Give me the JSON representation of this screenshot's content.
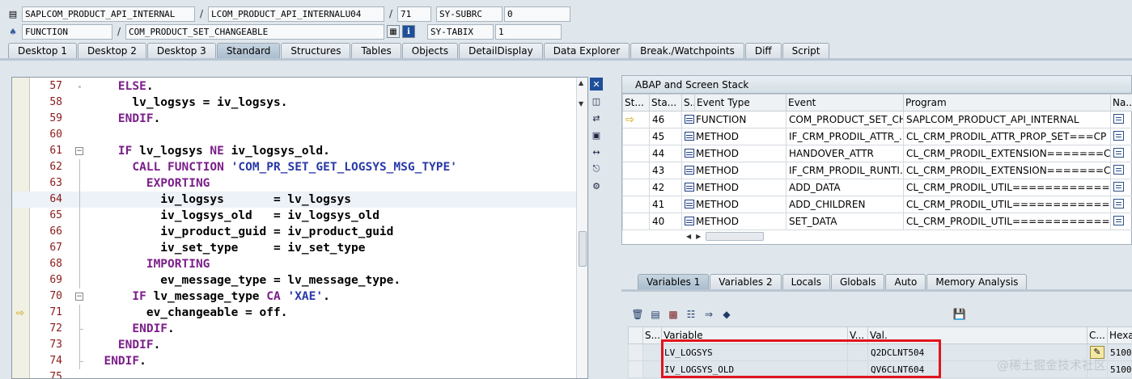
{
  "header": {
    "program": "SAPLCOM_PRODUCT_API_INTERNAL",
    "include": "LCOM_PRODUCT_API_INTERNALU04",
    "line": "71",
    "subrc_label": "SY-SUBRC",
    "subrc_value": "0",
    "event_type": "FUNCTION",
    "event": "COM_PRODUCT_SET_CHANGEABLE",
    "tabix_label": "SY-TABIX",
    "tabix_value": "1",
    "sep": "/",
    "info_btn": "i"
  },
  "main_tabs": [
    "Desktop 1",
    "Desktop 2",
    "Desktop 3",
    "Standard",
    "Structures",
    "Tables",
    "Objects",
    "DetailDisplay",
    "Data Explorer",
    "Break./Watchpoints",
    "Diff",
    "Script"
  ],
  "active_main_tab": "Standard",
  "code": [
    {
      "n": "57",
      "t": "    ELSE."
    },
    {
      "n": "58",
      "t": "      lv_logsys = iv_logsys."
    },
    {
      "n": "59",
      "t": "    ENDIF."
    },
    {
      "n": "60",
      "t": ""
    },
    {
      "n": "61",
      "t": "    IF lv_logsys NE iv_logsys_old."
    },
    {
      "n": "62",
      "t": "      CALL FUNCTION 'COM_PR_SET_GET_LOGSYS_MSG_TYPE'"
    },
    {
      "n": "63",
      "t": "        EXPORTING"
    },
    {
      "n": "64",
      "t": "          iv_logsys       = lv_logsys"
    },
    {
      "n": "65",
      "t": "          iv_logsys_old   = iv_logsys_old"
    },
    {
      "n": "66",
      "t": "          iv_product_guid = iv_product_guid"
    },
    {
      "n": "67",
      "t": "          iv_set_type     = iv_set_type"
    },
    {
      "n": "68",
      "t": "        IMPORTING"
    },
    {
      "n": "69",
      "t": "          ev_message_type = lv_message_type."
    },
    {
      "n": "70",
      "t": "      IF lv_message_type CA 'XAE'."
    },
    {
      "n": "71",
      "t": "        ev_changeable = off."
    },
    {
      "n": "72",
      "t": "      ENDIF."
    },
    {
      "n": "73",
      "t": "    ENDIF."
    },
    {
      "n": "74",
      "t": "  ENDIF."
    },
    {
      "n": "75",
      "t": ""
    }
  ],
  "stack": {
    "title": "ABAP and Screen Stack",
    "columns": [
      "St...",
      "Sta...",
      "S...",
      "Event Type",
      "Event",
      "Program",
      "Na..."
    ],
    "rows": [
      {
        "step": "46",
        "type": "FUNCTION",
        "event": "COM_PRODUCT_SET_CH...",
        "program": "SAPLCOM_PRODUCT_API_INTERNAL",
        "current": true
      },
      {
        "step": "45",
        "type": "METHOD",
        "event": "IF_CRM_PRODIL_ATTR_...",
        "program": "CL_CRM_PRODIL_ATTR_PROP_SET===CP",
        "current": false
      },
      {
        "step": "44",
        "type": "METHOD",
        "event": "HANDOVER_ATTR",
        "program": "CL_CRM_PRODIL_EXTENSION=======CP",
        "current": false
      },
      {
        "step": "43",
        "type": "METHOD",
        "event": "IF_CRM_PRODIL_RUNTI...",
        "program": "CL_CRM_PRODIL_EXTENSION=======CP",
        "current": false
      },
      {
        "step": "42",
        "type": "METHOD",
        "event": "ADD_DATA",
        "program": "CL_CRM_PRODIL_UTIL============CP",
        "current": false
      },
      {
        "step": "41",
        "type": "METHOD",
        "event": "ADD_CHILDREN",
        "program": "CL_CRM_PRODIL_UTIL============CP",
        "current": false
      },
      {
        "step": "40",
        "type": "METHOD",
        "event": "SET_DATA",
        "program": "CL_CRM_PRODIL_UTIL============CP",
        "current": false
      }
    ]
  },
  "var_tabs": [
    "Variables 1",
    "Variables 2",
    "Locals",
    "Globals",
    "Auto",
    "Memory Analysis"
  ],
  "active_var_tab": "Variables 1",
  "variables": {
    "columns": [
      "S...",
      "Variable",
      "V...",
      "Val.",
      "C...",
      "Hexa"
    ],
    "rows": [
      {
        "name": "LV_LOGSYS",
        "value": "Q2DCLNT504",
        "hex": "5100"
      },
      {
        "name": "IV_LOGSYS_OLD",
        "value": "QV6CLNT604",
        "hex": "5100"
      }
    ]
  },
  "watermark": "@稀土掘金技术社区"
}
